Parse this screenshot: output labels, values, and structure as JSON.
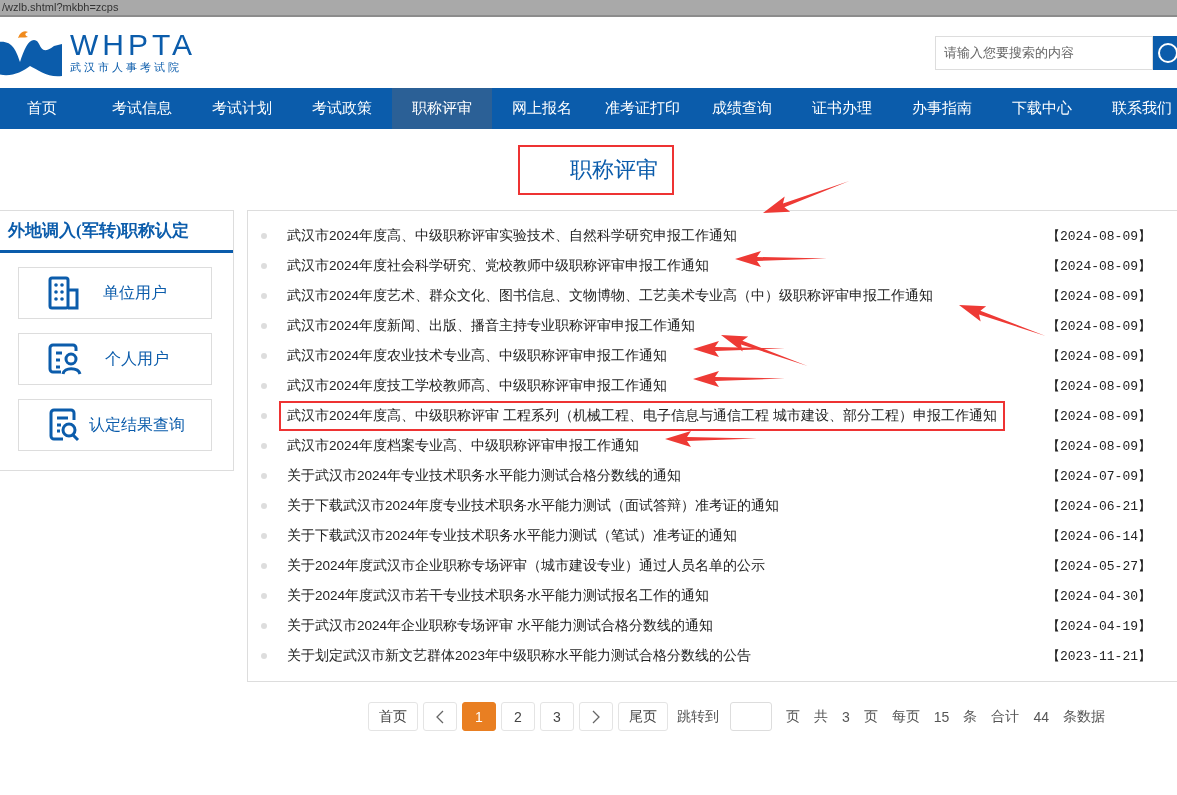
{
  "address_bar": {
    "url": "/wzlb.shtml?mkbh=zcps"
  },
  "logo": {
    "name": "WHPTA",
    "subtitle": "武汉市人事考试院"
  },
  "search": {
    "placeholder": "请输入您要搜索的内容"
  },
  "nav": [
    {
      "label": "首页",
      "selected": false
    },
    {
      "label": "考试信息",
      "selected": false
    },
    {
      "label": "考试计划",
      "selected": false
    },
    {
      "label": "考试政策",
      "selected": false
    },
    {
      "label": "职称评审",
      "selected": true
    },
    {
      "label": "网上报名",
      "selected": false
    },
    {
      "label": "准考证打印",
      "selected": false
    },
    {
      "label": "成绩查询",
      "selected": false
    },
    {
      "label": "证书办理",
      "selected": false
    },
    {
      "label": "办事指南",
      "selected": false
    },
    {
      "label": "下载中心",
      "selected": false
    },
    {
      "label": "联系我们",
      "selected": false
    }
  ],
  "page_title": {
    "text": "职称评审",
    "highlighted": true
  },
  "sidebar": {
    "title": "外地调入(军转)职称认定",
    "items": [
      {
        "label": "单位用户",
        "kind": "building"
      },
      {
        "label": "个人用户",
        "kind": "person"
      },
      {
        "label": "认定结果查询",
        "kind": "lookup"
      }
    ]
  },
  "notices": [
    {
      "title": "武汉市2024年度高、中级职称评审实验技术、自然科学研究申报工作通知",
      "date": "【2024-08-09】",
      "highlighted": false,
      "arrow": {
        "kind": "upper-right"
      }
    },
    {
      "title": "武汉市2024年度社会科学研究、党校教师中级职称评审申报工作通知",
      "date": "【2024-08-09】",
      "highlighted": false,
      "arrow": {
        "kind": "right"
      }
    },
    {
      "title": "武汉市2024年度艺术、群众文化、图书信息、文物博物、工艺美术专业高（中）级职称评审申报工作通知",
      "date": "【2024-08-09】",
      "highlighted": false,
      "arrow": {
        "kind": "lower-right"
      }
    },
    {
      "title": "武汉市2024年度新闻、出版、播音主持专业职称评审申报工作通知",
      "date": "【2024-08-09】",
      "highlighted": false,
      "arrow": {
        "kind": "lower-right"
      }
    },
    {
      "title": "武汉市2024年度农业技术专业高、中级职称评审申报工作通知",
      "date": "【2024-08-09】",
      "highlighted": false,
      "arrow": {
        "kind": "right"
      }
    },
    {
      "title": "武汉市2024年度技工学校教师高、中级职称评审申报工作通知",
      "date": "【2024-08-09】",
      "highlighted": false,
      "arrow": {
        "kind": "right"
      }
    },
    {
      "title": "武汉市2024年度高、中级职称评审 工程系列（机械工程、电子信息与通信工程 城市建设、部分工程）申报工作通知",
      "date": "【2024-08-09】",
      "highlighted": true
    },
    {
      "title": "武汉市2024年度档案专业高、中级职称评审申报工作通知",
      "date": "【2024-08-09】",
      "highlighted": false,
      "arrow": {
        "kind": "right"
      }
    },
    {
      "title": "关于武汉市2024年专业技术职务水平能力测试合格分数线的通知",
      "date": "【2024-07-09】",
      "highlighted": false
    },
    {
      "title": "关于下载武汉市2024年度专业技术职务水平能力测试（面试答辩）准考证的通知",
      "date": "【2024-06-21】",
      "highlighted": false
    },
    {
      "title": "关于下载武汉市2024年专业技术职务水平能力测试（笔试）准考证的通知",
      "date": "【2024-06-14】",
      "highlighted": false
    },
    {
      "title": "关于2024年度武汉市企业职称专场评审（城市建设专业）通过人员名单的公示",
      "date": "【2024-05-27】",
      "highlighted": false
    },
    {
      "title": "关于2024年度武汉市若干专业技术职务水平能力测试报名工作的通知",
      "date": "【2024-04-30】",
      "highlighted": false
    },
    {
      "title": "关于武汉市2024年企业职称专场评审 水平能力测试合格分数线的通知",
      "date": "【2024-04-19】",
      "highlighted": false
    },
    {
      "title": "关于划定武汉市新文艺群体2023年中级职称水平能力测试合格分数线的公告",
      "date": "【2023-11-21】",
      "highlighted": false
    }
  ],
  "pagination": {
    "first": "首页",
    "pages": [
      {
        "label": "1",
        "selected": true
      },
      {
        "label": "2",
        "selected": false
      },
      {
        "label": "3",
        "selected": false
      }
    ],
    "last": "尾页",
    "jump_label": "跳转到",
    "info": [
      "页",
      "共",
      "3",
      "页",
      "每页",
      "15",
      "条",
      "合计",
      "44",
      "条数据"
    ]
  }
}
